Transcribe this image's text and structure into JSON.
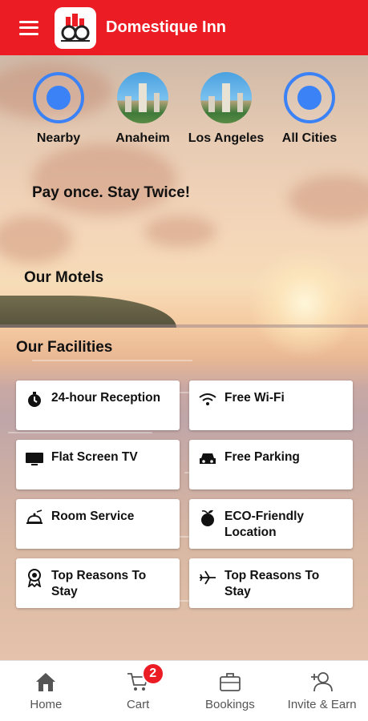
{
  "app": {
    "title": "Domestique Inn",
    "accent_color": "#ec1c24"
  },
  "cities": [
    {
      "label": "Nearby",
      "icon": "location-target-icon"
    },
    {
      "label": "Anaheim",
      "icon": "city-photo"
    },
    {
      "label": "Los Angeles",
      "icon": "city-photo"
    },
    {
      "label": "All Cities",
      "icon": "location-target-icon"
    }
  ],
  "tagline": "Pay once. Stay Twice!",
  "sections": {
    "motels": "Our Motels",
    "facilities": "Our Facilities"
  },
  "facilities": [
    {
      "label": "24-hour Reception",
      "icon": "stopwatch-icon"
    },
    {
      "label": "Free Wi-Fi",
      "icon": "wifi-icon"
    },
    {
      "label": "Flat Screen TV",
      "icon": "tv-icon"
    },
    {
      "label": "Free Parking",
      "icon": "car-icon"
    },
    {
      "label": "Room Service",
      "icon": "room-service-icon"
    },
    {
      "label": "ECO-Friendly Location",
      "icon": "eco-icon"
    },
    {
      "label": "Top Reasons To Stay",
      "icon": "award-icon"
    },
    {
      "label": "Top Reasons To Stay",
      "icon": "airplane-icon"
    }
  ],
  "bottom_nav": {
    "home": "Home",
    "cart": "Cart",
    "cart_count": "2",
    "bookings": "Bookings",
    "invite": "Invite & Earn"
  }
}
